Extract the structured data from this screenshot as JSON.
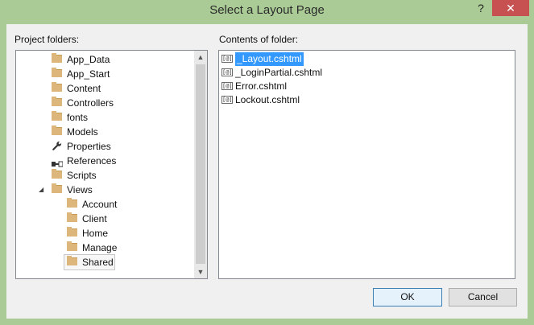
{
  "window": {
    "title": "Select a Layout Page",
    "help_label": "?",
    "close_label": "✕"
  },
  "project_folders": {
    "label": "Project folders:",
    "items": [
      {
        "label": "App_Data",
        "icon": "folder-icon"
      },
      {
        "label": "App_Start",
        "icon": "folder-icon"
      },
      {
        "label": "Content",
        "icon": "folder-icon"
      },
      {
        "label": "Controllers",
        "icon": "folder-icon"
      },
      {
        "label": "fonts",
        "icon": "folder-icon"
      },
      {
        "label": "Models",
        "icon": "folder-icon"
      },
      {
        "label": "Properties",
        "icon": "wrench-icon"
      },
      {
        "label": "References",
        "icon": "references-icon"
      },
      {
        "label": "Scripts",
        "icon": "folder-icon"
      },
      {
        "label": "Views",
        "icon": "folder-icon",
        "expanded": true
      },
      {
        "label": "Account",
        "icon": "folder-icon"
      },
      {
        "label": "Client",
        "icon": "folder-icon"
      },
      {
        "label": "Home",
        "icon": "folder-icon"
      },
      {
        "label": "Manage",
        "icon": "folder-icon"
      },
      {
        "label": "Shared",
        "icon": "folder-icon",
        "selected": true
      }
    ],
    "expand_glyph": "◢"
  },
  "contents": {
    "label": "Contents of folder:",
    "file_icon_text": "[@]",
    "files": [
      {
        "name": "_Layout.cshtml",
        "selected": true
      },
      {
        "name": "_LoginPartial.cshtml"
      },
      {
        "name": "Error.cshtml"
      },
      {
        "name": "Lockout.cshtml"
      }
    ]
  },
  "buttons": {
    "ok_label": "OK",
    "cancel_label": "Cancel"
  },
  "scrollbar": {
    "up": "▲",
    "down": "▼"
  },
  "colors": {
    "frame": "#aacb96",
    "close": "#c75050",
    "selection": "#3399ff"
  }
}
